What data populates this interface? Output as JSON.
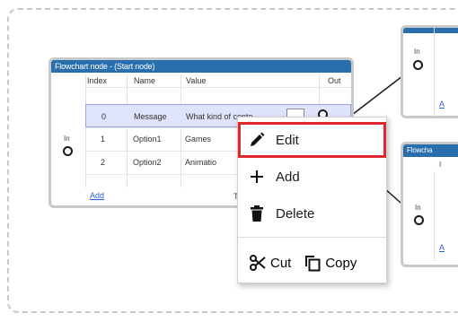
{
  "main_node": {
    "title": "Flowchart node - (Start node)",
    "columns": [
      "Index",
      "Name",
      "Value",
      "Out"
    ],
    "in_label": "In",
    "rows": [
      {
        "index": "0",
        "name": "Message",
        "value": "What kind of conte"
      },
      {
        "index": "1",
        "name": "Option1",
        "value": "Games"
      },
      {
        "index": "2",
        "name": "Option2",
        "value": "Animatio"
      }
    ],
    "add_link": "Add",
    "footer_text": "Ta"
  },
  "right_nodes": {
    "top_in_label": "In",
    "top_link": "A",
    "bottom_title": "Flowcha",
    "bottom_col": "I",
    "bottom_in_label": "In",
    "bottom_link": "A"
  },
  "context_menu": {
    "items": [
      {
        "label": "Edit",
        "icon": "pencil-icon",
        "highlighted": true
      },
      {
        "label": "Add",
        "icon": "plus-icon"
      },
      {
        "label": "Delete",
        "icon": "trash-icon"
      }
    ],
    "cut_label": "Cut",
    "copy_label": "Copy"
  },
  "colors": {
    "header_blue": "#2a6fad",
    "selection": "#dfe3fb",
    "highlight_red": "#e0282d",
    "link_blue": "#2b5cd8"
  }
}
